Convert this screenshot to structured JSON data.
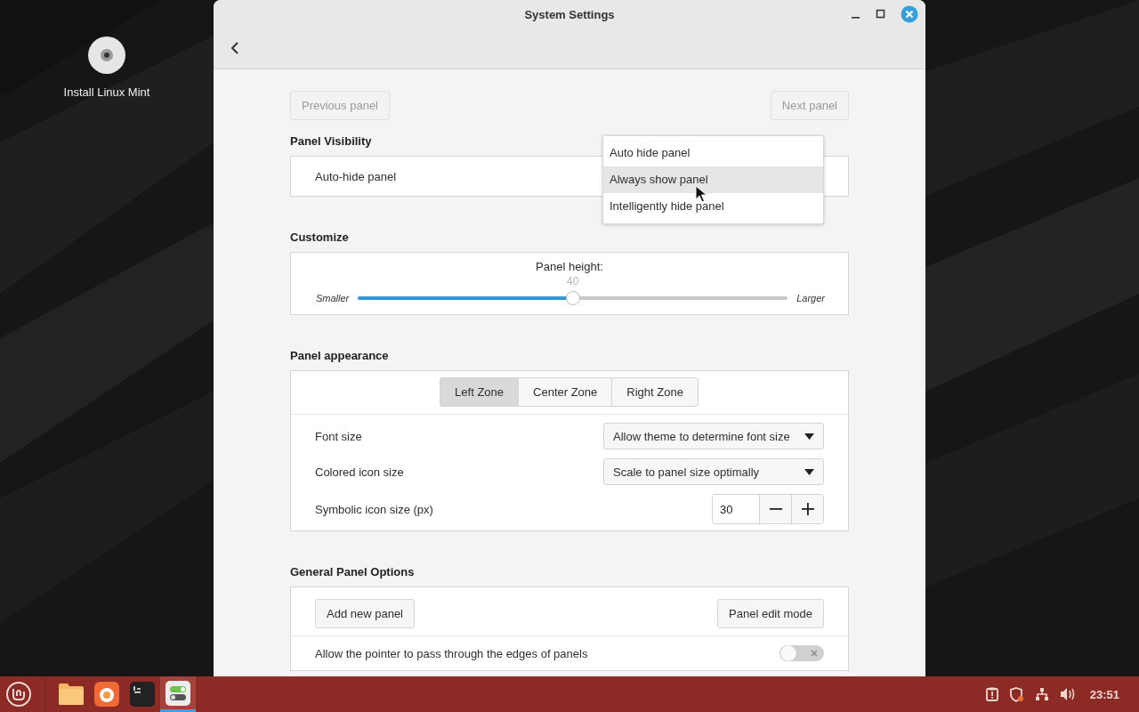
{
  "desktop": {
    "icons": [
      {
        "label": "Install Linux Mint"
      }
    ]
  },
  "window": {
    "title": "System Settings"
  },
  "nav": [
    {
      "label": "Previous panel",
      "disabled": true
    },
    {
      "label": "Next panel",
      "disabled": true
    }
  ],
  "panel_visibility": {
    "heading": "Panel Visibility",
    "label": "Auto-hide panel",
    "menu": [
      {
        "label": "Auto hide panel",
        "selected": false
      },
      {
        "label": "Always show panel",
        "selected": true
      },
      {
        "label": "Intelligently hide panel",
        "selected": false
      }
    ]
  },
  "customize": {
    "heading": "Customize",
    "label": "Panel height:",
    "reading": "40",
    "min_label": "Smaller",
    "max_label": "Larger",
    "level": 0.5
  },
  "panel_appearance": {
    "heading": "Panel appearance",
    "tabs": [
      {
        "label": "Left Zone",
        "selected": true
      },
      {
        "label": "Center Zone",
        "selected": false
      },
      {
        "label": "Right Zone",
        "selected": false
      }
    ],
    "rows": [
      {
        "kind": "combo",
        "label": "Font size",
        "value": "Allow theme to determine font size"
      },
      {
        "kind": "combo",
        "label": "Colored icon size",
        "value": "Scale to panel size optimally"
      },
      {
        "kind": "spin",
        "label": "Symbolic icon size (px)",
        "value": "30"
      }
    ]
  },
  "general": {
    "heading": "General Panel Options",
    "buttons": [
      "Add new panel",
      "Panel edit mode"
    ],
    "toggle": {
      "label": "Allow the pointer to pass through the edges of panels",
      "on": false
    }
  },
  "taskbar": {
    "apps": [
      {
        "kind": "folder",
        "active": false
      },
      {
        "kind": "browser",
        "active": false
      },
      {
        "kind": "terminal",
        "active": false
      },
      {
        "kind": "settings",
        "active": true
      }
    ],
    "clock": "23:51"
  }
}
